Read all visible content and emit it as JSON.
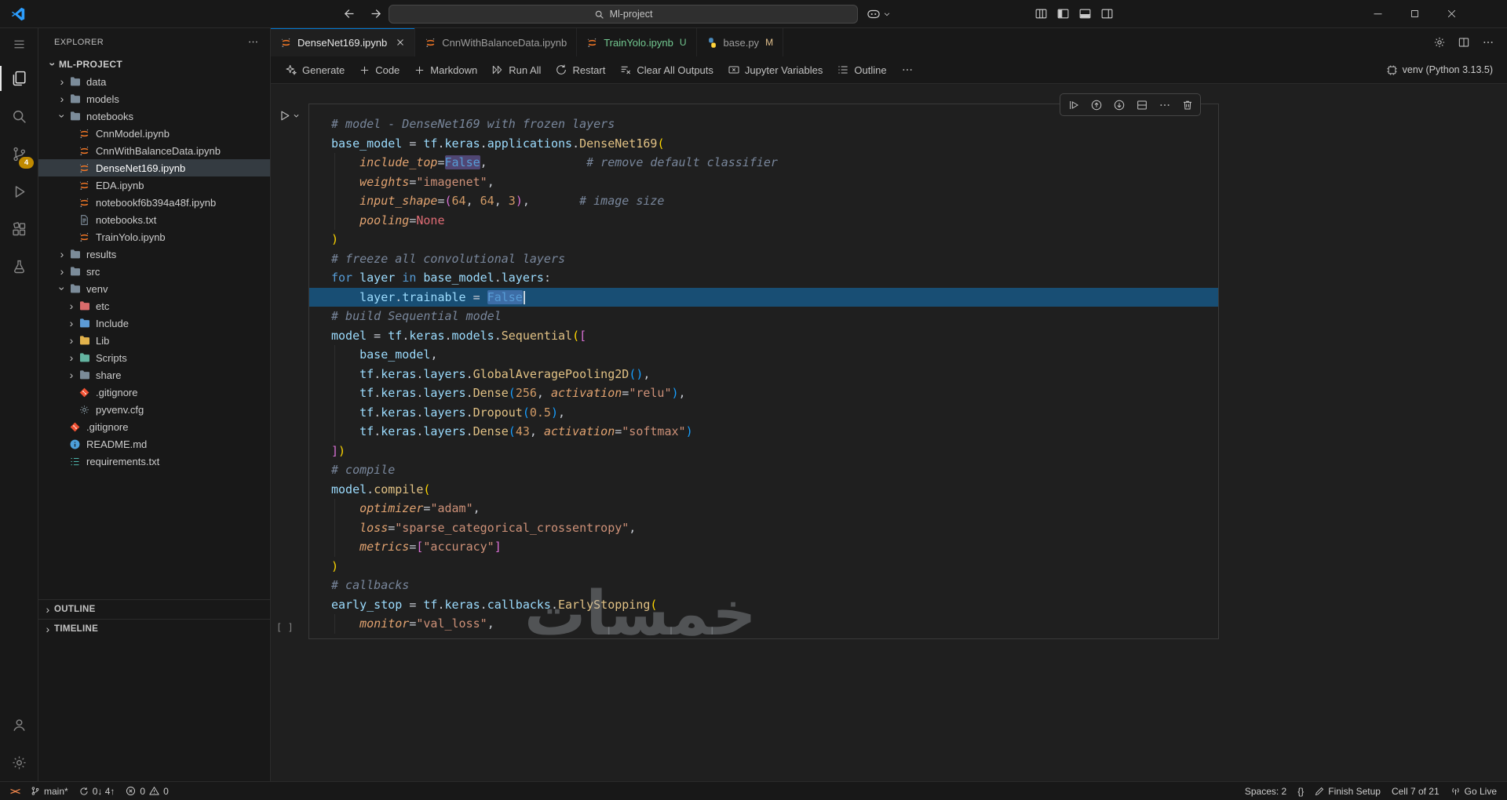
{
  "titlebar": {
    "search_value": "Ml-project"
  },
  "activity_bar": {
    "badge_color": "#C08A00",
    "items": [
      {
        "name": "menu",
        "small": true
      },
      {
        "name": "explorer",
        "active": true
      },
      {
        "name": "search"
      },
      {
        "name": "source-control",
        "badge": "4"
      },
      {
        "name": "run-debug"
      },
      {
        "name": "extensions"
      },
      {
        "name": "testing"
      }
    ],
    "bottom_items": [
      {
        "name": "account"
      },
      {
        "name": "settings"
      }
    ]
  },
  "sidebar": {
    "title": "EXPLORER",
    "bottom_sections": [
      "OUTLINE",
      "TIMELINE"
    ],
    "tree": [
      {
        "label": "ML-PROJECT",
        "level": 0,
        "chevron": "down",
        "root": true
      },
      {
        "label": "data",
        "level": 1,
        "chevron": "right",
        "icon": "folder",
        "color": "#7B8B99"
      },
      {
        "label": "models",
        "level": 1,
        "chevron": "right",
        "icon": "folder",
        "color": "#7B8B99"
      },
      {
        "label": "notebooks",
        "level": 1,
        "chevron": "down",
        "icon": "folder",
        "color": "#7B8B99"
      },
      {
        "label": "CnnModel.ipynb",
        "level": 2,
        "icon": "jupyter"
      },
      {
        "label": "CnnWithBalanceData.ipynb",
        "level": 2,
        "icon": "jupyter"
      },
      {
        "label": "DenseNet169.ipynb",
        "level": 2,
        "icon": "jupyter",
        "selected": true
      },
      {
        "label": "EDA.ipynb",
        "level": 2,
        "icon": "jupyter"
      },
      {
        "label": "notebookf6b394a48f.ipynb",
        "level": 2,
        "icon": "jupyter"
      },
      {
        "label": "notebooks.txt",
        "level": 2,
        "icon": "text-file"
      },
      {
        "label": "TrainYolo.ipynb",
        "level": 2,
        "icon": "jupyter"
      },
      {
        "label": "results",
        "level": 1,
        "chevron": "right",
        "icon": "folder",
        "color": "#7B8B99"
      },
      {
        "label": "src",
        "level": 1,
        "chevron": "right",
        "icon": "folder",
        "color": "#7B8B99"
      },
      {
        "label": "venv",
        "level": 1,
        "chevron": "down",
        "icon": "folder",
        "color": "#7B8B99"
      },
      {
        "label": "etc",
        "level": 2,
        "chevron": "right",
        "icon": "folder",
        "color": "#D96B6B"
      },
      {
        "label": "Include",
        "level": 2,
        "chevron": "right",
        "icon": "folder",
        "color": "#5C9BD6"
      },
      {
        "label": "Lib",
        "level": 2,
        "chevron": "right",
        "icon": "folder",
        "color": "#E2B24C"
      },
      {
        "label": "Scripts",
        "level": 2,
        "chevron": "right",
        "icon": "folder",
        "color": "#63B3A0"
      },
      {
        "label": "share",
        "level": 2,
        "chevron": "right",
        "icon": "folder",
        "color": "#7B8B99"
      },
      {
        "label": ".gitignore",
        "level": 2,
        "icon": "git"
      },
      {
        "label": "pyvenv.cfg",
        "level": 2,
        "icon": "gear-file"
      },
      {
        "label": ".gitignore",
        "level": 1,
        "icon": "git"
      },
      {
        "label": "README.md",
        "level": 1,
        "icon": "info"
      },
      {
        "label": "requirements.txt",
        "level": 1,
        "icon": "req-list"
      }
    ]
  },
  "tabs": [
    {
      "label": "DenseNet169.ipynb",
      "icon": "jupyter",
      "active": true,
      "close": true
    },
    {
      "label": "CnnWithBalanceData.ipynb",
      "icon": "jupyter"
    },
    {
      "label": "TrainYolo.ipynb",
      "icon": "jupyter",
      "badge": "U",
      "label_color": "#73C991",
      "badge_color": "#73C991"
    },
    {
      "label": "base.py",
      "icon": "python",
      "badge": "M",
      "badge_color": "#E2C08D"
    }
  ],
  "tab_actions": [
    {
      "name": "gear"
    },
    {
      "name": "split-editor"
    },
    {
      "name": "more"
    }
  ],
  "notebook_toolbar": {
    "items": [
      {
        "name": "generate",
        "icon": "sparkle",
        "label": "Generate"
      },
      {
        "name": "add-code",
        "icon": "add",
        "label": "Code"
      },
      {
        "name": "add-markdown",
        "icon": "add",
        "label": "Markdown"
      },
      {
        "name": "run-all",
        "icon": "run-all",
        "label": "Run All"
      },
      {
        "name": "restart",
        "icon": "restart",
        "label": "Restart"
      },
      {
        "name": "clear-all-outputs",
        "icon": "clear-outputs",
        "label": "Clear All Outputs"
      },
      {
        "name": "jupyter-variables",
        "icon": "variables",
        "label": "Jupyter Variables"
      },
      {
        "name": "outline",
        "icon": "outline-list",
        "label": "Outline"
      },
      {
        "name": "more-actions",
        "icon": "more",
        "label": ""
      }
    ],
    "kernel": {
      "icon": "kernel-env",
      "label": "venv (Python 3.13.5)"
    }
  },
  "cell": {
    "toolbar_icons": [
      "run-by-line",
      "execute-above",
      "execute-below",
      "split-cell",
      "more",
      "trash"
    ],
    "execution_placeholder": "[ ]"
  },
  "code": {
    "lines": [
      {
        "t": [
          [
            "# model - DenseNet169 with frozen layers",
            "c"
          ]
        ]
      },
      {
        "t": [
          [
            "base_model",
            "v"
          ],
          [
            " = ",
            "o"
          ],
          [
            "tf",
            "v"
          ],
          [
            ".",
            "o"
          ],
          [
            "keras",
            "v"
          ],
          [
            ".",
            "o"
          ],
          [
            "applications",
            "v"
          ],
          [
            ".",
            "o"
          ],
          [
            "DenseNet169",
            "f"
          ],
          [
            "(",
            "b1"
          ]
        ]
      },
      {
        "ind": 1,
        "t": [
          [
            "include_top",
            "p"
          ],
          [
            "=",
            "o"
          ],
          [
            "False",
            "kc occ"
          ],
          [
            ",",
            "o"
          ],
          [
            "              ",
            "o"
          ],
          [
            "# remove default classifier",
            "c"
          ]
        ]
      },
      {
        "ind": 1,
        "t": [
          [
            "weights",
            "p"
          ],
          [
            "=",
            "o"
          ],
          [
            "\"imagenet\"",
            "s"
          ],
          [
            ",",
            "o"
          ]
        ]
      },
      {
        "ind": 1,
        "t": [
          [
            "input_shape",
            "p"
          ],
          [
            "=",
            "o"
          ],
          [
            "(",
            "b2"
          ],
          [
            "64",
            "n1"
          ],
          [
            ", ",
            "o"
          ],
          [
            "64",
            "n1"
          ],
          [
            ", ",
            "o"
          ],
          [
            "3",
            "n1"
          ],
          [
            ")",
            "b2"
          ],
          [
            ",",
            "o"
          ],
          [
            "       ",
            "o"
          ],
          [
            "# image size",
            "c"
          ]
        ]
      },
      {
        "ind": 1,
        "t": [
          [
            "pooling",
            "p"
          ],
          [
            "=",
            "o"
          ],
          [
            "None",
            "n0"
          ]
        ]
      },
      {
        "t": [
          [
            ")",
            "b1"
          ]
        ]
      },
      {
        "t": [
          [
            "# freeze all convolutional layers",
            "c"
          ]
        ]
      },
      {
        "t": [
          [
            "for",
            "k"
          ],
          [
            " ",
            "o"
          ],
          [
            "layer",
            "v"
          ],
          [
            " ",
            "o"
          ],
          [
            "in",
            "k"
          ],
          [
            " ",
            "o"
          ],
          [
            "base_model",
            "v"
          ],
          [
            ".",
            "o"
          ],
          [
            "layers",
            "v"
          ],
          [
            ":",
            "o"
          ]
        ]
      },
      {
        "ind": 1,
        "hl": true,
        "t": [
          [
            "layer",
            "v"
          ],
          [
            ".",
            "o"
          ],
          [
            "trainable",
            "v"
          ],
          [
            " = ",
            "o"
          ],
          [
            "False",
            "kc sel"
          ],
          [
            "",
            "cursor"
          ]
        ]
      },
      {
        "t": [
          [
            "# build Sequential model",
            "c"
          ]
        ]
      },
      {
        "t": [
          [
            "model",
            "v"
          ],
          [
            " = ",
            "o"
          ],
          [
            "tf",
            "v"
          ],
          [
            ".",
            "o"
          ],
          [
            "keras",
            "v"
          ],
          [
            ".",
            "o"
          ],
          [
            "models",
            "v"
          ],
          [
            ".",
            "o"
          ],
          [
            "Sequential",
            "f"
          ],
          [
            "(",
            "b1"
          ],
          [
            "[",
            "b2"
          ]
        ]
      },
      {
        "ind": 1,
        "t": [
          [
            "base_model",
            "v"
          ],
          [
            ",",
            "o"
          ]
        ]
      },
      {
        "ind": 1,
        "t": [
          [
            "tf",
            "v"
          ],
          [
            ".",
            "o"
          ],
          [
            "keras",
            "v"
          ],
          [
            ".",
            "o"
          ],
          [
            "layers",
            "v"
          ],
          [
            ".",
            "o"
          ],
          [
            "GlobalAveragePooling2D",
            "f"
          ],
          [
            "()",
            "b3"
          ],
          [
            ",",
            "o"
          ]
        ]
      },
      {
        "ind": 1,
        "t": [
          [
            "tf",
            "v"
          ],
          [
            ".",
            "o"
          ],
          [
            "keras",
            "v"
          ],
          [
            ".",
            "o"
          ],
          [
            "layers",
            "v"
          ],
          [
            ".",
            "o"
          ],
          [
            "Dense",
            "f"
          ],
          [
            "(",
            "b3"
          ],
          [
            "256",
            "n1"
          ],
          [
            ", ",
            "o"
          ],
          [
            "activation",
            "p"
          ],
          [
            "=",
            "o"
          ],
          [
            "\"relu\"",
            "s"
          ],
          [
            ")",
            "b3"
          ],
          [
            ",",
            "o"
          ]
        ]
      },
      {
        "ind": 1,
        "t": [
          [
            "tf",
            "v"
          ],
          [
            ".",
            "o"
          ],
          [
            "keras",
            "v"
          ],
          [
            ".",
            "o"
          ],
          [
            "layers",
            "v"
          ],
          [
            ".",
            "o"
          ],
          [
            "Dropout",
            "f"
          ],
          [
            "(",
            "b3"
          ],
          [
            "0.5",
            "n1"
          ],
          [
            ")",
            "b3"
          ],
          [
            ",",
            "o"
          ]
        ]
      },
      {
        "ind": 1,
        "t": [
          [
            "tf",
            "v"
          ],
          [
            ".",
            "o"
          ],
          [
            "keras",
            "v"
          ],
          [
            ".",
            "o"
          ],
          [
            "layers",
            "v"
          ],
          [
            ".",
            "o"
          ],
          [
            "Dense",
            "f"
          ],
          [
            "(",
            "b3"
          ],
          [
            "43",
            "n1"
          ],
          [
            ", ",
            "o"
          ],
          [
            "activation",
            "p"
          ],
          [
            "=",
            "o"
          ],
          [
            "\"softmax\"",
            "s"
          ],
          [
            ")",
            "b3"
          ]
        ]
      },
      {
        "t": [
          [
            "]",
            "b2"
          ],
          [
            ")",
            "b1"
          ]
        ]
      },
      {
        "t": [
          [
            "# compile",
            "c"
          ]
        ]
      },
      {
        "t": [
          [
            "model",
            "v"
          ],
          [
            ".",
            "o"
          ],
          [
            "compile",
            "f"
          ],
          [
            "(",
            "b1"
          ]
        ]
      },
      {
        "ind": 1,
        "t": [
          [
            "optimizer",
            "p"
          ],
          [
            "=",
            "o"
          ],
          [
            "\"adam\"",
            "s"
          ],
          [
            ",",
            "o"
          ]
        ]
      },
      {
        "ind": 1,
        "t": [
          [
            "loss",
            "p"
          ],
          [
            "=",
            "o"
          ],
          [
            "\"sparse_categorical_crossentropy\"",
            "s"
          ],
          [
            ",",
            "o"
          ]
        ]
      },
      {
        "ind": 1,
        "t": [
          [
            "metrics",
            "p"
          ],
          [
            "=",
            "o"
          ],
          [
            "[",
            "b2"
          ],
          [
            "\"accuracy\"",
            "s"
          ],
          [
            "]",
            "b2"
          ]
        ]
      },
      {
        "t": [
          [
            ")",
            "b1"
          ]
        ]
      },
      {
        "t": [
          [
            "# callbacks",
            "c"
          ]
        ]
      },
      {
        "t": [
          [
            "early_stop",
            "v"
          ],
          [
            " = ",
            "o"
          ],
          [
            "tf",
            "v"
          ],
          [
            ".",
            "o"
          ],
          [
            "keras",
            "v"
          ],
          [
            ".",
            "o"
          ],
          [
            "callbacks",
            "v"
          ],
          [
            ".",
            "o"
          ],
          [
            "EarlyStopping",
            "f"
          ],
          [
            "(",
            "b1"
          ]
        ]
      },
      {
        "ind": 1,
        "t": [
          [
            "monitor",
            "p"
          ],
          [
            "=",
            "o"
          ],
          [
            "\"val_loss\"",
            "s"
          ],
          [
            ",",
            "o"
          ]
        ]
      }
    ]
  },
  "status_bar": {
    "left": [
      {
        "name": "remote-indicator",
        "color": "#E8834A",
        "parts": [
          {
            "icon": "remote"
          }
        ]
      },
      {
        "name": "git-branch",
        "parts": [
          {
            "icon": "branch-small"
          },
          {
            "text": "main*"
          }
        ]
      },
      {
        "name": "git-sync",
        "parts": [
          {
            "icon": "sync-small"
          },
          {
            "text": "0↓ 4↑"
          }
        ]
      },
      {
        "name": "problems",
        "parts": [
          {
            "icon": "error-small"
          },
          {
            "text": "0"
          },
          {
            "icon": "warning-small"
          },
          {
            "text": "0"
          }
        ]
      }
    ],
    "right": [
      {
        "name": "indentation",
        "parts": [
          {
            "text": "Spaces: 2"
          }
        ]
      },
      {
        "name": "language-mode",
        "parts": [
          {
            "text": "{}"
          }
        ]
      },
      {
        "name": "finish-setup",
        "parts": [
          {
            "icon": "pencil"
          },
          {
            "text": "Finish Setup"
          }
        ]
      },
      {
        "name": "cell-indicator",
        "parts": [
          {
            "text": "Cell 7 of 21"
          }
        ]
      },
      {
        "name": "go-live",
        "parts": [
          {
            "icon": "broadcast"
          },
          {
            "text": "Go Live"
          }
        ]
      }
    ]
  },
  "watermark": {
    "text": "خمسات"
  }
}
